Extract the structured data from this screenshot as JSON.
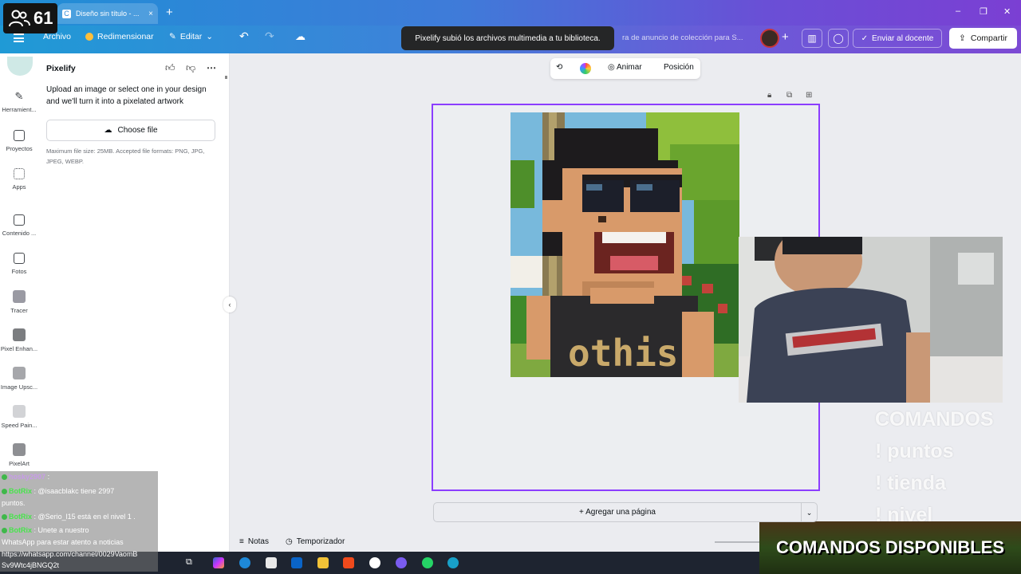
{
  "stream": {
    "viewer_count": "61"
  },
  "browser": {
    "tab_title": "Diseño sin título - ...",
    "tab_close": "×",
    "new_tab": "+",
    "window_controls": [
      "–",
      "❐",
      "✕"
    ]
  },
  "header": {
    "menu_file": "Archivo",
    "resize": "Redimensionar",
    "edit": "Editar",
    "doc_title": "ra de anuncio de colección para S...",
    "send_teacher": "Enviar al docente",
    "share": "Compartir",
    "plus": "+"
  },
  "toast": {
    "message": "Pixelify subió los archivos multimedia a tu biblioteca."
  },
  "rail": {
    "items": [
      {
        "label": "Herramient..."
      },
      {
        "label": "Proyectos"
      },
      {
        "label": "Apps"
      },
      {
        "label": "Contenido ..."
      },
      {
        "label": "Fotos"
      },
      {
        "label": "Tracer"
      },
      {
        "label": "Pixel Enhan..."
      },
      {
        "label": "Image Upsc..."
      },
      {
        "label": "Speed Pain..."
      },
      {
        "label": "PixelArt"
      }
    ]
  },
  "panel": {
    "title": "Pixelify",
    "description": "Upload an image or select one in your design and we'll turn it into a pixelated artwork",
    "choose_file": "Choose file",
    "note": "Maximum file size: 25MB. Accepted file formats: PNG, JPG, JPEG, WEBP."
  },
  "floatbar": {
    "animate": "Animar",
    "position": "Posición"
  },
  "canvas": {
    "shirt_text": "othis",
    "add_page": "+ Agregar una página"
  },
  "footer": {
    "notes": "Notas",
    "timer": "Temporizador"
  },
  "overlay": {
    "commands_header": "COMANDOS",
    "commands": [
      "! puntos",
      "! tienda",
      "! nivel"
    ],
    "banner": "COMANDOS DISPONIBLES"
  },
  "chat": {
    "lines": [
      {
        "user": "hosky2907",
        "text": ":"
      },
      {
        "user": "BotRix",
        "text": ": @isaacblakc tiene 2997"
      },
      {
        "user": "",
        "text": "puntos."
      },
      {
        "user": "BotRix",
        "text": ": @Serio_l15 está en el nivel 1 ."
      },
      {
        "user": "BotRix",
        "text": ": Unete a nuestro"
      },
      {
        "user": "",
        "text": "WhatsApp para estar atento a noticias"
      },
      {
        "user": "",
        "text": "https://whatsapp.com/channel/0029VaomB"
      },
      {
        "user": "",
        "text": "Sv9Wtc4jBNGQ2t"
      }
    ]
  },
  "colors": {
    "accent": "#8b3dff",
    "header_start": "#1f9ad6",
    "header_end": "#7c4ad4"
  }
}
